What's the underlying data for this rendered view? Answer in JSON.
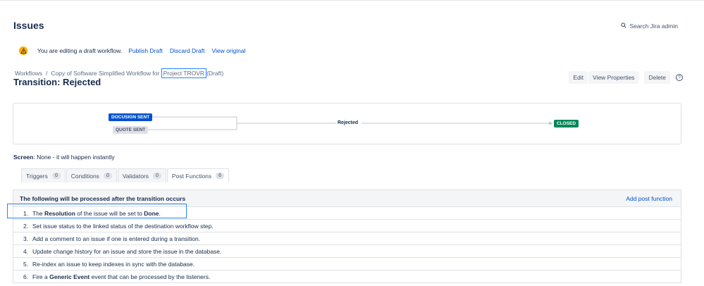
{
  "header": {
    "title": "Issues",
    "search_label": "Search Jira admin"
  },
  "draft_bar": {
    "message": "You are editing a draft workflow.",
    "publish": "Publish Draft",
    "discard": "Discard Draft",
    "view_original": "View original"
  },
  "breadcrumb": {
    "root": "Workflows",
    "separator": "/",
    "workflow_prefix": "Copy of Software Simplified Workflow for",
    "workflow_project": "Project TROVR",
    "workflow_suffix": "(Draft)"
  },
  "transition": {
    "title": "Transition: Rejected"
  },
  "actions": {
    "edit": "Edit",
    "view_properties": "View Properties",
    "delete": "Delete",
    "help": "?"
  },
  "diagram": {
    "from_statuses": [
      "DOCUSIGN SENT",
      "QUOTE SENT"
    ],
    "transition_name": "Rejected",
    "to_status": "CLOSED",
    "colors": {
      "in_progress": "#0052cc",
      "todo": "#dfe1e6",
      "done": "#00875a"
    }
  },
  "screen": {
    "label": "Screen",
    "value": ": None - it will happen instantly"
  },
  "tabs": [
    {
      "label": "Triggers",
      "count": "0"
    },
    {
      "label": "Conditions",
      "count": "0"
    },
    {
      "label": "Validators",
      "count": "0"
    },
    {
      "label": "Post Functions",
      "count": "6"
    }
  ],
  "post_functions": {
    "header": "The following will be processed after the transition occurs",
    "add_label": "Add post function",
    "items": [
      {
        "num": "1.",
        "pre": "The ",
        "b1": "Resolution",
        "mid": " of the issue will be set to ",
        "b2": "Done",
        "post": "."
      },
      {
        "num": "2.",
        "text": "Set issue status to the linked status of the destination workflow step."
      },
      {
        "num": "3.",
        "text": "Add a comment to an issue if one is entered during a transition."
      },
      {
        "num": "4.",
        "text": "Update change history for an issue and store the issue in the database."
      },
      {
        "num": "5.",
        "text": "Re-index an issue to keep indexes in sync with the database."
      },
      {
        "num": "6.",
        "pre": "Fire a ",
        "b1": "Generic Event",
        "post": " event that can be processed by the listeners."
      }
    ]
  }
}
